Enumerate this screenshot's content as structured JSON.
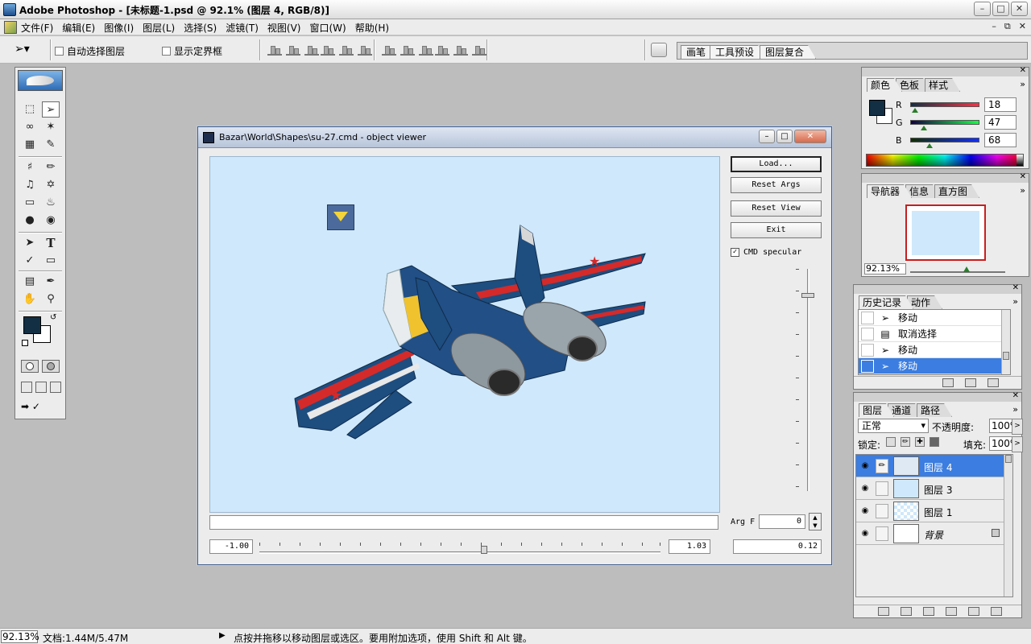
{
  "app": {
    "title": "Adobe Photoshop - [未标题-1.psd @ 92.1% (图层 4, RGB/8)]",
    "window_buttons": [
      "0",
      "1",
      "r"
    ]
  },
  "menu": {
    "items": [
      "文件(F)",
      "编辑(E)",
      "图像(I)",
      "图层(L)",
      "选择(S)",
      "滤镜(T)",
      "视图(V)",
      "窗口(W)",
      "帮助(H)"
    ],
    "doc_controls": [
      "–",
      "⧉",
      "✕"
    ]
  },
  "options": {
    "auto_select_layer": "自动选择图层",
    "show_bounding_box": "显示定界框",
    "palette_tabs": [
      "画笔",
      "工具预设",
      "图层复合"
    ]
  },
  "viewer": {
    "title": "Bazar\\World\\Shapes\\su-27.cmd - object viewer",
    "buttons": {
      "load": "Load...",
      "reset_args": "Reset Args",
      "reset_view": "Reset View",
      "exit": "Exit"
    },
    "specular_label": "CMD specular",
    "specular_checked": "✓",
    "arg_label": "Arg F",
    "arg_value": "0",
    "min_value": "-1.00",
    "max_value": "1.03",
    "current_value": "0.12",
    "status_text": ""
  },
  "color_panel": {
    "tabs": [
      "颜色",
      "色板",
      "样式"
    ],
    "channels": [
      {
        "label": "R",
        "value": "18",
        "color": "#c8283c"
      },
      {
        "label": "G",
        "value": "47",
        "color": "#28b450"
      },
      {
        "label": "B",
        "value": "68",
        "color": "#2848b4"
      }
    ],
    "foreground": "#122f44"
  },
  "navigator_panel": {
    "tabs": [
      "导航器",
      "信息",
      "直方图"
    ],
    "zoom": "92.13%"
  },
  "history_panel": {
    "tabs": [
      "历史记录",
      "动作"
    ],
    "items": [
      {
        "label": "移动",
        "icon": "move-icon"
      },
      {
        "label": "取消选择",
        "icon": "deselect-icon"
      },
      {
        "label": "移动",
        "icon": "move-icon"
      },
      {
        "label": "移动",
        "icon": "move-icon"
      }
    ]
  },
  "layers_panel": {
    "tabs": [
      "图层",
      "通道",
      "路径"
    ],
    "blend_mode": "正常",
    "opacity_label": "不透明度:",
    "opacity": "100%",
    "lock_label": "锁定:",
    "fill_label": "填充:",
    "fill": "100%",
    "layers": [
      {
        "name": "图层 4",
        "selected": true
      },
      {
        "name": "图层 3",
        "selected": false
      },
      {
        "name": "图层 1",
        "selected": false
      },
      {
        "name": "背景",
        "selected": false
      }
    ]
  },
  "status": {
    "zoom": "92.13%",
    "doc": "文档:1.44M/5.47M",
    "hint": "点按并拖移以移动图层或选区。要用附加选项，使用 Shift 和 Alt 键。"
  }
}
